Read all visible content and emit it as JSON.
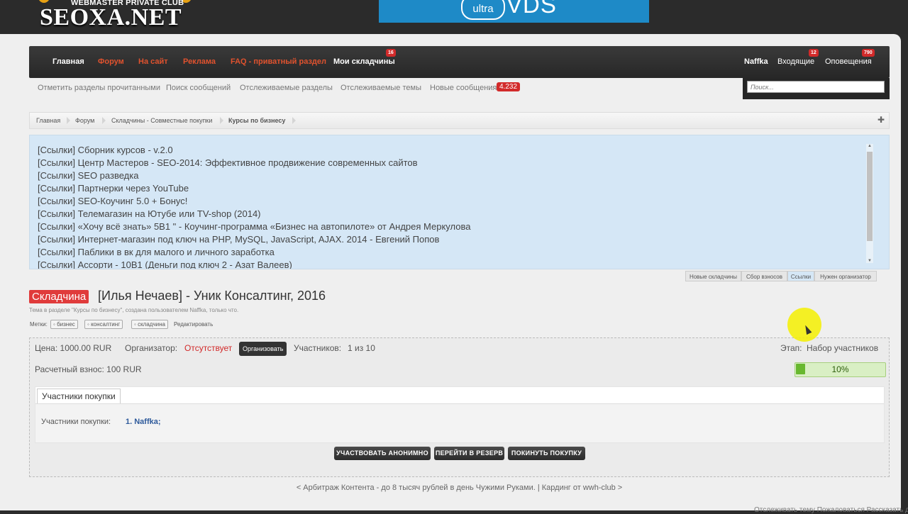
{
  "header": {
    "logo_club": "WEBMASTER PRIVATE CLUB",
    "logo_name": "SEOXA.NET",
    "ad_prefix": "ultra",
    "ad_text": "VDS"
  },
  "nav": {
    "items": [
      {
        "label": "Главная",
        "color": "#ffffff"
      },
      {
        "label": "Форум",
        "color": "#e0522e"
      },
      {
        "label": "На сайт",
        "color": "#e0522e"
      },
      {
        "label": "Реклама",
        "color": "#e0522e"
      },
      {
        "label": "FAQ - приватный раздел",
        "color": "#e0522e"
      },
      {
        "label": "Мои складчины",
        "color": "#ffffff",
        "badge": "16"
      }
    ],
    "right": [
      {
        "label": "Naffka"
      },
      {
        "label": "Входящие",
        "badge": "12"
      },
      {
        "label": "Оповещения",
        "badge": "790"
      }
    ],
    "search_placeholder": "Поиск..."
  },
  "subnav": {
    "items": [
      "Отметить разделы прочитанными",
      "Поиск сообщений",
      "Отслеживаемые разделы",
      "Отслеживаемые темы",
      "Новые сообщения"
    ],
    "new_count": "4.232"
  },
  "breadcrumb": [
    "Главная",
    "Форум",
    "Складчины - Совместные покупки",
    "Курсы по бизнесу"
  ],
  "links": [
    "[Ссылки] Сборник курсов - v.2.0",
    "[Ссылки] Центр Мастеров - SEO-2014: Эффективное продвижение современных сайтов",
    "[Ссылки] SEO разведка",
    "[Ссылки] Партнерки через YouTube",
    "[Ссылки] SEO-Коучинг 5.0 + Бонус!",
    "[Ссылки] Телемагазин на Ютубе или TV-shop (2014)",
    "[Ссылки] «Хочу всё знать» 5В1 \" - Коучинг-программа «Бизнес на автопилоте» от Андрея Меркулова",
    "[Ссылки] Интернет-магазин под ключ на PHP, MySQL, JavaScript, AJAX. 2014 - Евгений Попов",
    "[Ссылки] Паблики в вк для малого и личного заработка",
    "[Ссылки] Ассорти - 10В1 (Деньги под ключ 2 - Азат Валеев)"
  ],
  "link_tabs": [
    {
      "label": "Новые складчины",
      "active": false
    },
    {
      "label": "Сбор взносов",
      "active": false
    },
    {
      "label": "Ссылки",
      "active": true
    },
    {
      "label": "Нужен организатор",
      "active": false
    }
  ],
  "thread": {
    "badge": "Складчина",
    "title": "[Илья Нечаев] - Уник Консалтинг, 2016",
    "meta": "Тема в разделе \"Курсы по бизнесу\", создана пользователем Naffka, только что.",
    "tags_label": "Метки:",
    "tags": [
      "бизнес",
      "консалтинг",
      "складчина"
    ],
    "edit_tags": "Редактировать"
  },
  "purchase": {
    "price": "Цена: 1000.00 RUR",
    "organizer_label": "Организатор:",
    "organizer_status": "Отсутствует",
    "organize_button": "Организовать",
    "participants_label": "Участников:",
    "participants_value": "1 из 10",
    "stage_label": "Этап:",
    "stage_value": "Набор участников",
    "fee": "Расчетный взнос: 100 RUR",
    "progress_percent": 10,
    "progress_label": "10%",
    "tab_label": "Участники покупки",
    "list_label": "Участники покупки:",
    "list_value": "1. Naffka;",
    "buttons": [
      "УЧАСТВОВАТЬ АНОНИМНО",
      "ПЕРЕЙТИ В РЕЗЕРВ",
      "ПОКИНУТЬ ПОКУПКУ"
    ]
  },
  "footer": {
    "prev_next": "< Арбитраж Контента - до 8 тысяч рублей в день Чужими Руками. | Кардинг от wwh-club >",
    "cut_text": "Отслеживать тему   Пожаловаться   Рассказать друзьям"
  },
  "colors": {
    "accent_red": "#d22a2a",
    "nav_orange": "#e0522e",
    "link_box": "#d5e7f6",
    "progress_green": "#68b82f"
  }
}
